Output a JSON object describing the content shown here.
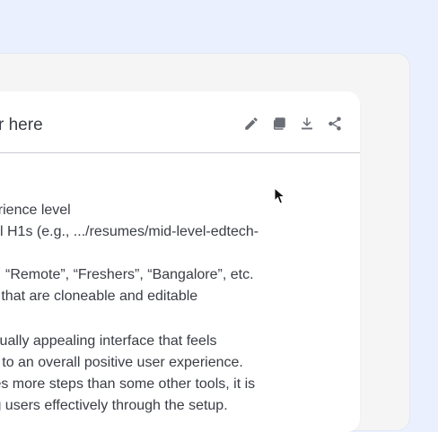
{
  "editor": {
    "title": "r here",
    "toolbar": {
      "edit_icon": "pencil-icon",
      "copy_icon": "copy-icon",
      "download_icon": "download-icon",
      "share_icon": "share-icon"
    },
    "body_lines": [
      "perience level",
      "l H1s (e.g., .../resumes/mid-level-edtech-",
      "“Remote”, “Freshers”, “Bangalore”, etc.",
      "es that are cloneable and editable",
      "visually appealing interface that feels",
      "ng to an overall positive user experience.",
      "ides more steps than some other tools, it is",
      "ing users effectively through the setup."
    ]
  },
  "colors": {
    "page_bg": "#eaf0fd",
    "panel_bg": "#f5f5f6",
    "card_bg": "#ffffff",
    "text": "#3a3d45",
    "icon": "#6b6e76",
    "divider": "#c9ccd2"
  }
}
